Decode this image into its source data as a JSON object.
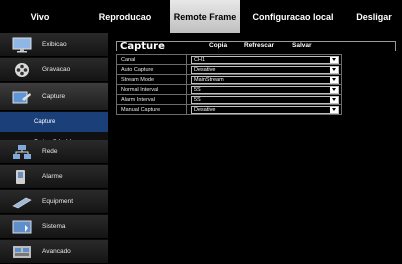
{
  "topnav": {
    "tabs": [
      {
        "label": "Vivo"
      },
      {
        "label": "Reproducao"
      },
      {
        "label": "Remote Frame",
        "active": true
      },
      {
        "label": "Configuracao local"
      },
      {
        "label": "Desligar"
      }
    ]
  },
  "sidebar": {
    "items": [
      {
        "label": "Exibicao",
        "icon": "monitor-icon"
      },
      {
        "label": "Gravacao",
        "icon": "film-reel-icon"
      },
      {
        "label": "Capture",
        "icon": "capture-icon"
      },
      {
        "label": "Capture",
        "sub": true,
        "selected": true
      },
      {
        "label": "Capture Schedule",
        "sub": true
      },
      {
        "label": "Rede",
        "icon": "network-icon"
      },
      {
        "label": "Alarme",
        "icon": "alarm-icon"
      },
      {
        "label": "Equipment",
        "icon": "equipment-icon"
      },
      {
        "label": "Sistema",
        "icon": "system-icon"
      },
      {
        "label": "Avancado",
        "icon": "advanced-icon"
      }
    ]
  },
  "main": {
    "title": "Capture",
    "actions": {
      "copy": "Copia",
      "refresh": "Refrescar",
      "save": "Salvar"
    },
    "rows": [
      {
        "key": "Canal",
        "value": "CH1"
      },
      {
        "key": "Auto Capture",
        "value": "Desative"
      },
      {
        "key": "Stream Mode",
        "value": "MainStream"
      },
      {
        "key": "Normal Interval",
        "value": "5S"
      },
      {
        "key": "Alarm Interval",
        "value": "5S"
      },
      {
        "key": "Manual Capture",
        "value": "Desative"
      }
    ]
  }
}
